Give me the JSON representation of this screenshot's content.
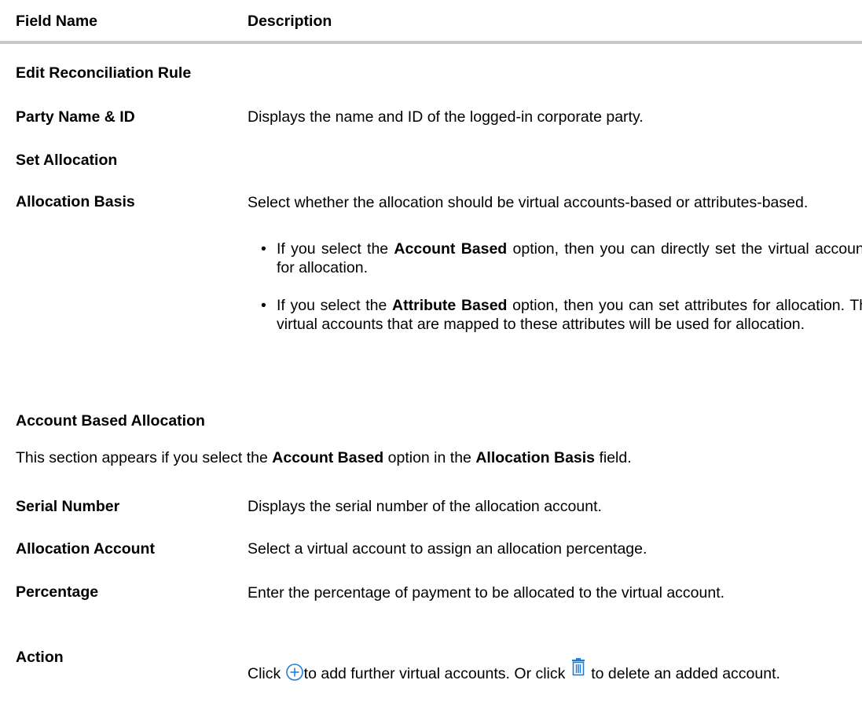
{
  "header": {
    "field_name": "Field Name",
    "description": "Description"
  },
  "sections": {
    "edit_rule": "Edit Reconciliation Rule",
    "set_allocation": "Set Allocation",
    "account_based": "Account Based Allocation"
  },
  "rows": {
    "party": {
      "name": "Party Name & ID",
      "desc": "Displays the name and ID of the logged-in corporate party."
    },
    "allocation_basis": {
      "name": "Allocation Basis",
      "desc": "Select whether the allocation should be virtual accounts-based or attributes-based.",
      "bullet1_pre": "If you select the ",
      "bullet1_bold": "Account Based",
      "bullet1_post": " option, then you can directly set the virtual accounts for allocation.",
      "bullet2_pre": "If you select the ",
      "bullet2_bold": "Attribute Based",
      "bullet2_post": " option, then you can set attributes for allocation. The virtual accounts that are mapped to these attributes will be used for allocation."
    },
    "serial": {
      "name": "Serial Number",
      "desc": "Displays the serial number of the allocation account."
    },
    "allocation_account": {
      "name": "Allocation Account",
      "desc": "Select a virtual account to assign an allocation percentage."
    },
    "percentage": {
      "name": "Percentage",
      "desc": "Enter the percentage of payment to be allocated to the virtual account."
    },
    "action": {
      "name": "Action",
      "desc_click": "Click ",
      "desc_mid": "to add further virtual accounts. Or click ",
      "desc_end": " to delete an added account."
    }
  },
  "account_note": {
    "pre": "This section appears if you select the ",
    "bold1": "Account Based",
    "mid": " option in the ",
    "bold2": "Allocation Basis",
    "post": " field."
  },
  "icons": {
    "add": "add-circle-icon",
    "delete": "trash-icon",
    "accent": "#1f7fd6"
  }
}
